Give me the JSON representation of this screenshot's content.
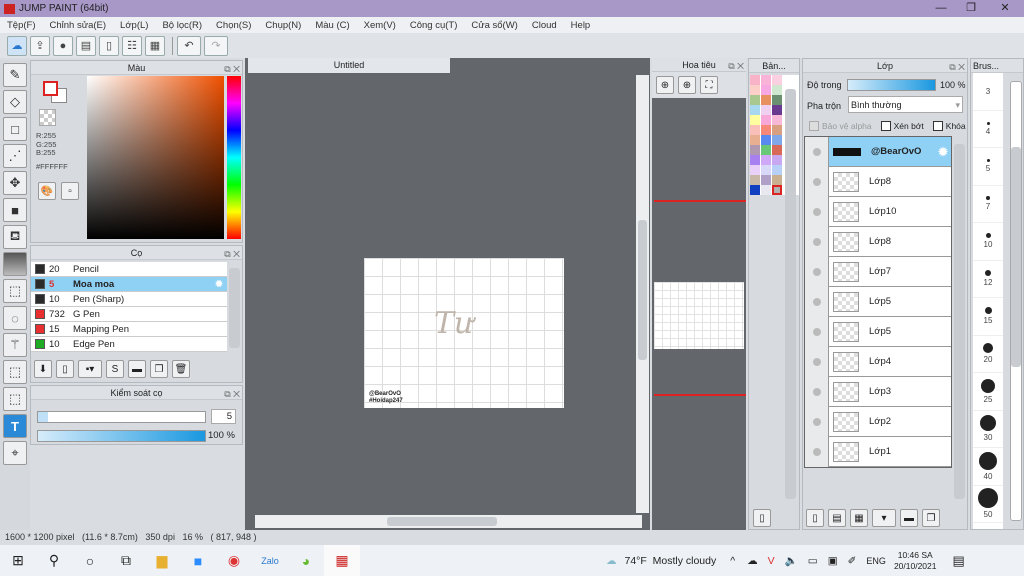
{
  "app": {
    "title": "JUMP PAINT (64bit)"
  },
  "menu": [
    "Tệp(F)",
    "Chỉnh sửa(E)",
    "Lớp(L)",
    "Bộ lọc(R)",
    "Chọn(S)",
    "Chụp(N)",
    "Màu (C)",
    "Xem(V)",
    "Công cụ(T)",
    "Cửa sổ(W)",
    "Cloud",
    "Help"
  ],
  "color_panel": {
    "title": "Màu",
    "r": "R:255",
    "g": "G:255",
    "b": "B:255",
    "hex": "#FFFFFF"
  },
  "brush_panel": {
    "title": "Cọ",
    "items": [
      {
        "size": "20",
        "name": "Pencil",
        "color": "#2a2a2a"
      },
      {
        "size": "5",
        "name": "Moa moa",
        "color": "#2a2a2a",
        "selected": true
      },
      {
        "size": "10",
        "name": "Pen (Sharp)",
        "color": "#2a2a2a"
      },
      {
        "size": "732",
        "name": "G Pen",
        "color": "#e83030"
      },
      {
        "size": "15",
        "name": "Mapping Pen",
        "color": "#e83030"
      },
      {
        "size": "10",
        "name": "Edge Pen",
        "color": "#22aa22"
      }
    ]
  },
  "brush_control": {
    "title": "Kiểm soát cọ",
    "size": "5",
    "size_fraction": 0.06,
    "opacity": "100 %",
    "opacity_fraction": 1.0
  },
  "canvas": {
    "tab": "Untitled",
    "artwork_text": "Tư",
    "watermark1": "@BearOvO",
    "watermark2": "#Hoidap247"
  },
  "navigator": {
    "title": "Hoa tiêu"
  },
  "palette": {
    "title": "Bản...",
    "colors": [
      "#f9b3c8",
      "#f9b3d8",
      "#fbd0e0",
      "#fcd0c8",
      "#f8a8e0",
      "#cfe8cf",
      "#a8c890",
      "#e89060",
      "#6a9070",
      "#a8d8f0",
      "#f0d0f0",
      "#6a3a90",
      "#ffffa0",
      "#f8a8d8",
      "#f8b8d8",
      "#f8c0b8",
      "#f88878",
      "#d8a080",
      "#e8b090",
      "#5888f0",
      "#80a8e8",
      "#b098b0",
      "#68c878",
      "#d86858",
      "#a880f0",
      "#d0a8f8",
      "#c8a8f0",
      "#e8d0f8",
      "#d8d8f8",
      "#b8d0f8",
      "#c8b8a8",
      "#b0a0c8",
      "#c8b090",
      "#1040c0",
      "#e8e8f0",
      "#b0b0b0"
    ]
  },
  "layer_panel": {
    "title": "Lớp",
    "opacity_label": "Độ trong",
    "opacity": "100 %",
    "blend_label": "Pha trộn",
    "blend": "Bình thường",
    "protect_alpha": "Bảo vệ alpha",
    "clip": "Xén bớt",
    "lock": "Khóa",
    "layers": [
      "@BearOvO",
      "Lớp8",
      "Lớp10",
      "Lớp8",
      "Lớp7",
      "Lớp5",
      "Lớp5",
      "Lớp4",
      "Lớp3",
      "Lớp2",
      "Lớp1"
    ]
  },
  "brush_size_panel": {
    "title": "Brus...",
    "sizes": [
      "3",
      "4",
      "5",
      "7",
      "10",
      "12",
      "15",
      "20",
      "25",
      "30",
      "40",
      "50",
      ""
    ]
  },
  "status": "1600 * 1200 pixel   (11.6 * 8.7cm)   350 dpi   16 %   ( 817, 948 )",
  "taskbar": {
    "weather": "74°F  Mostly cloudy",
    "lang": "ENG",
    "time": "10:46 SA",
    "date": "20/10/2021"
  }
}
